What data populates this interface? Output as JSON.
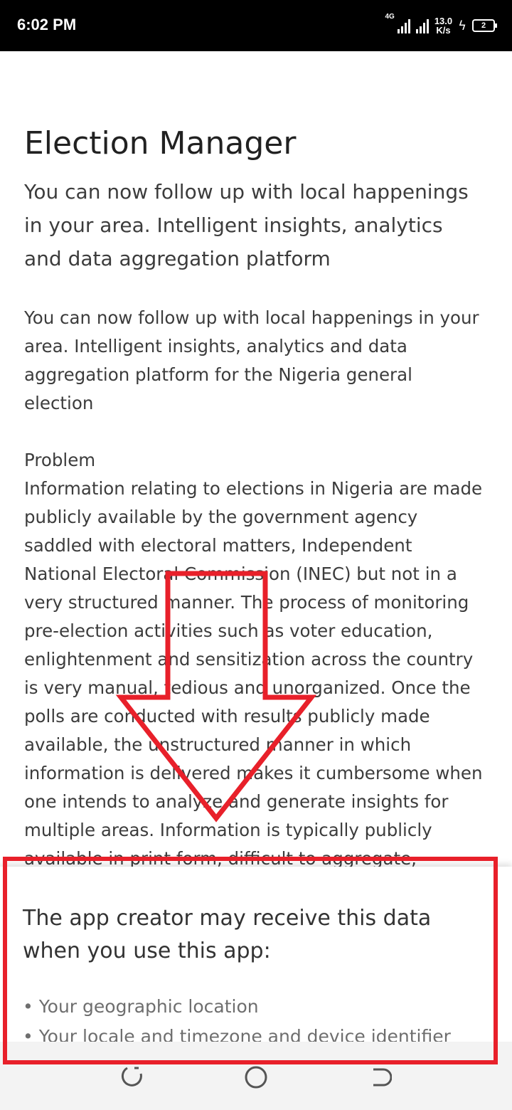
{
  "status_bar": {
    "time": "6:02 PM",
    "network_type": "4G",
    "speed_value": "13.0",
    "speed_unit": "K/s",
    "battery_level": "2"
  },
  "content": {
    "title": "Election Manager",
    "subtitle": "You can now follow up with local happenings in your area. Intelligent insights, analytics and data aggregation platform",
    "description": "You can now follow up with local happenings in your area. Intelligent insights, analytics and data aggregation platform for the Nigeria general election\n\nProblem\nInformation relating to elections in Nigeria are made publicly available by the government agency saddled with electoral matters, Independent National Electoral Commission (INEC) but not in a very structured manner. The process of monitoring pre-election activities such as voter education, enlightenment and sensitization across the country is very manual, tedious and unorganized. Once the polls are conducted with results publicly made available, the unstructured manner in which information is delivered makes it cumbersome when one intends to analyze and generate insights for multiple areas. Information is typically publicly available in print form, difficult to aggregate,"
  },
  "permission_sheet": {
    "heading": "The app creator may receive this data when you use this app:",
    "items": [
      "Your geographic location",
      "Your locale and timezone and device identifier"
    ]
  },
  "nav_bar": {
    "recent_icon": "recent-apps-icon",
    "home_icon": "home-icon",
    "back_icon": "back-icon"
  },
  "annotation": {
    "color": "#e8202a"
  }
}
